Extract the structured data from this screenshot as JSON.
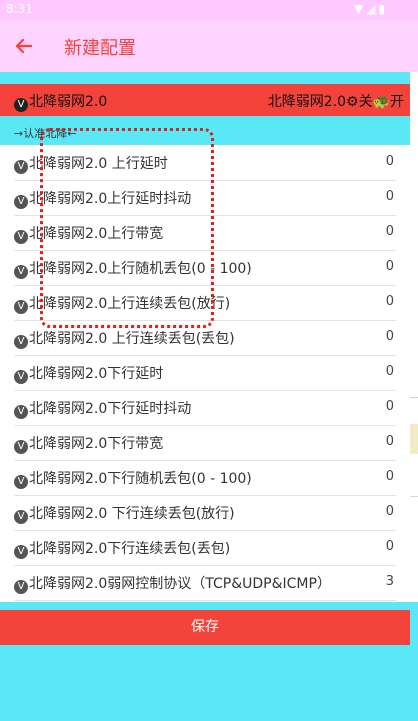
{
  "status_bar": {
    "time": "8:31"
  },
  "toolbar": {
    "title": "新建配置",
    "back_icon": "arrow-left-icon"
  },
  "master": {
    "label": "北降弱网2.0",
    "right_prefix": "北降弱网2.0",
    "off": "关",
    "on": "开"
  },
  "note": "→认准北降←",
  "items": [
    {
      "label": "北降弱网2.0 上行延时",
      "value": "0"
    },
    {
      "label": "北降弱网2.0上行延时抖动",
      "value": "0"
    },
    {
      "label": "北降弱网2.0上行带宽",
      "value": "0"
    },
    {
      "label": "北降弱网2.0上行随机丢包(0 - 100)",
      "value": "0"
    },
    {
      "label": "北降弱网2.0上行连续丢包(放行)",
      "value": "0"
    },
    {
      "label": "北降弱网2.0 上行连续丢包(丢包)",
      "value": "0"
    },
    {
      "label": "北降弱网2.0下行延时",
      "value": "0"
    },
    {
      "label": "北降弱网2.0下行延时抖动",
      "value": "0"
    },
    {
      "label": "北降弱网2.0下行带宽",
      "value": "0"
    },
    {
      "label": "北降弱网2.0下行随机丢包(0 - 100)",
      "value": "0"
    },
    {
      "label": "北降弱网2.0 下行连续丢包(放行)",
      "value": "0"
    },
    {
      "label": "北降弱网2.0下行连续丢包(丢包)",
      "value": "0"
    },
    {
      "label": "北降弱网2.0弱网控制协议（TCP&UDP&ICMP）",
      "value": "3"
    }
  ],
  "save_label": "保存",
  "colors": {
    "accent": "#f4433a",
    "toolbar_bg": "#ffd3ff",
    "page_bg": "#5ae8f6"
  }
}
